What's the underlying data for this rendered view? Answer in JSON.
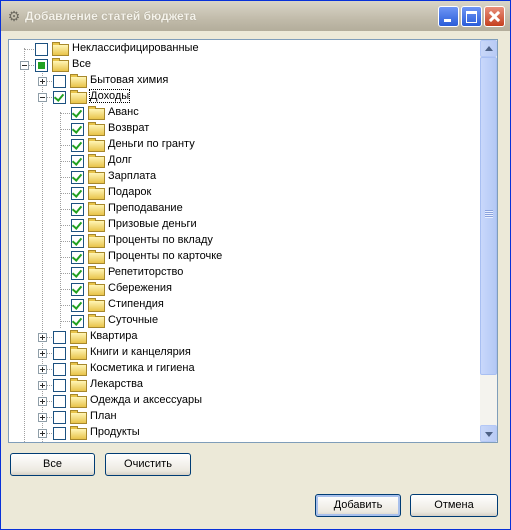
{
  "window": {
    "title": "Добавление статей бюджета"
  },
  "tree": [
    {
      "label": "Неклассифицированные",
      "level": 0,
      "check": "none",
      "expander": null
    },
    {
      "label": "Все",
      "level": 0,
      "check": "partial",
      "expander": "minus"
    },
    {
      "label": "Бытовая химия",
      "level": 1,
      "check": "none",
      "expander": "plus"
    },
    {
      "label": "Доходы",
      "level": 1,
      "check": "checked",
      "expander": "minus",
      "selected": true
    },
    {
      "label": "Аванс",
      "level": 2,
      "check": "checked",
      "expander": null
    },
    {
      "label": "Возврат",
      "level": 2,
      "check": "checked",
      "expander": null
    },
    {
      "label": "Деньги по гранту",
      "level": 2,
      "check": "checked",
      "expander": null
    },
    {
      "label": "Долг",
      "level": 2,
      "check": "checked",
      "expander": null
    },
    {
      "label": "Зарплата",
      "level": 2,
      "check": "checked",
      "expander": null
    },
    {
      "label": "Подарок",
      "level": 2,
      "check": "checked",
      "expander": null
    },
    {
      "label": "Преподавание",
      "level": 2,
      "check": "checked",
      "expander": null
    },
    {
      "label": "Призовые деньги",
      "level": 2,
      "check": "checked",
      "expander": null
    },
    {
      "label": "Проценты по вкладу",
      "level": 2,
      "check": "checked",
      "expander": null
    },
    {
      "label": "Проценты по карточке",
      "level": 2,
      "check": "checked",
      "expander": null
    },
    {
      "label": "Репетиторство",
      "level": 2,
      "check": "checked",
      "expander": null
    },
    {
      "label": "Сбережения",
      "level": 2,
      "check": "checked",
      "expander": null
    },
    {
      "label": "Стипендия",
      "level": 2,
      "check": "checked",
      "expander": null
    },
    {
      "label": "Суточные",
      "level": 2,
      "check": "checked",
      "expander": null
    },
    {
      "label": "Квартира",
      "level": 1,
      "check": "none",
      "expander": "plus"
    },
    {
      "label": "Книги и канцелярия",
      "level": 1,
      "check": "none",
      "expander": "plus"
    },
    {
      "label": "Косметика и гигиена",
      "level": 1,
      "check": "none",
      "expander": "plus"
    },
    {
      "label": "Лекарства",
      "level": 1,
      "check": "none",
      "expander": "plus"
    },
    {
      "label": "Одежда и аксессуары",
      "level": 1,
      "check": "none",
      "expander": "plus"
    },
    {
      "label": "План",
      "level": 1,
      "check": "none",
      "expander": "plus"
    },
    {
      "label": "Продукты",
      "level": 1,
      "check": "none",
      "expander": "plus"
    }
  ],
  "buttons": {
    "select_all": "Все",
    "clear": "Очистить",
    "add": "Добавить",
    "cancel": "Отмена"
  }
}
